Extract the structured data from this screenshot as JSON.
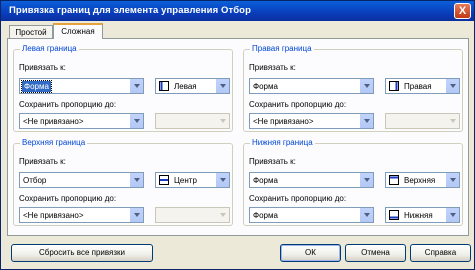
{
  "window": {
    "title": "Привязка границ для элемента управления Отбор",
    "close_label": "X"
  },
  "tabs": [
    {
      "label": "Простой"
    },
    {
      "label": "Сложная"
    }
  ],
  "groups": {
    "left": {
      "title": "Левая граница",
      "bind_label": "Привязать к:",
      "bind_value": "Форма",
      "side_value": "Левая",
      "keep_label": "Сохранить пропорцию до:",
      "keep_value": "<Не привязано>",
      "keep2_value": ""
    },
    "right": {
      "title": "Правая граница",
      "bind_label": "Привязать к:",
      "bind_value": "Форма",
      "side_value": "Правая",
      "keep_label": "Сохранить пропорцию до:",
      "keep_value": "<Не привязано>",
      "keep2_value": ""
    },
    "top": {
      "title": "Верхняя граница",
      "bind_label": "Привязать к:",
      "bind_value": "Отбор",
      "side_value": "Центр",
      "keep_label": "Сохранить пропорцию до:",
      "keep_value": "<Не привязано>",
      "keep2_value": ""
    },
    "bottom": {
      "title": "Нижняя граница",
      "bind_label": "Привязать к:",
      "bind_value": "Форма",
      "side_value": "Верхняя",
      "keep_label": "Сохранить пропорцию до:",
      "keep_value": "Форма",
      "keep2_value": "Нижняя"
    }
  },
  "buttons": {
    "reset": "Сбросить все привязки",
    "ok": "ОК",
    "cancel": "Отмена",
    "help": "Справка"
  },
  "icons": {
    "left_side": "align-left-icon",
    "right_side": "align-right-icon",
    "top_side": "align-center-icon",
    "bottom_side": "align-top-icon",
    "bottom_keep": "align-bottom-icon"
  }
}
